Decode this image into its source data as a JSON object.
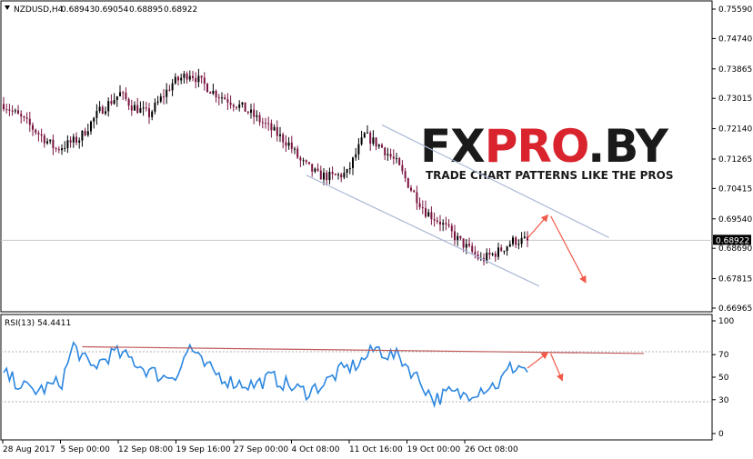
{
  "header": {
    "symbol": "NZDUSD,H4",
    "open": "0.68943",
    "high": "0.69054",
    "low": "0.68895",
    "close": "0.68922"
  },
  "watermark": {
    "logo": "FXPRO.BY",
    "tagline": "TRADE CHART PATTERNS LIKE THE PROS"
  },
  "colors": {
    "bull_candle": "#000000",
    "bear_candle": "#7a1240",
    "rsi_line": "#2b86e0",
    "channel_line": "#aab8d6",
    "trend_line": "#c05a5a",
    "arrow": "#f25a4a",
    "logo_dark": "#1a1a1a",
    "logo_accent": "#d9232d"
  },
  "chart_data": [
    {
      "type": "candlestick",
      "title": "NZDUSD,H4 0.68943 0.69054 0.68895 0.68922",
      "current_price": "0.68922",
      "ylim": [
        0.66965,
        0.7559
      ],
      "y_ticks": [
        "0.75590",
        "0.74740",
        "0.73865",
        "0.73015",
        "0.72140",
        "0.71265",
        "0.70415",
        "0.69540",
        "0.68922",
        "0.68690",
        "0.67815",
        "0.66965"
      ],
      "x_ticks": [
        "28 Aug 2017",
        "5 Sep 00:00",
        "12 Sep 08:00",
        "19 Sep 16:00",
        "27 Sep 00:00",
        "4 Oct 08:00",
        "11 Oct 16:00",
        "19 Oct 00:00",
        "26 Oct 08:00"
      ],
      "close_anchors": {
        "bar_index": [
          0,
          8,
          18,
          26,
          33,
          40,
          44,
          50,
          58,
          64,
          72,
          82,
          90,
          98,
          102,
          108,
          113,
          118,
          124,
          130,
          135,
          140,
          145,
          150,
          156,
          164,
          170,
          175,
          180
        ],
        "close": [
          0.7285,
          0.723,
          0.7155,
          0.7185,
          0.7265,
          0.7315,
          0.728,
          0.7255,
          0.7345,
          0.7375,
          0.732,
          0.7275,
          0.7225,
          0.717,
          0.712,
          0.708,
          0.7075,
          0.7085,
          0.7195,
          0.716,
          0.7115,
          0.704,
          0.6975,
          0.6945,
          0.6895,
          0.6835,
          0.686,
          0.689,
          0.6892
        ]
      },
      "annotations": [
        {
          "kind": "channel_line",
          "from": [
            "bar 130",
            0.7225
          ],
          "to": [
            "bar 208",
            0.69
          ]
        },
        {
          "kind": "channel_line",
          "from": [
            "bar 104",
            0.708
          ],
          "to": [
            "bar 184",
            0.676
          ]
        },
        {
          "kind": "arrow",
          "from": [
            "bar 180",
            0.6898
          ],
          "to": [
            "bar 187",
            0.6965
          ]
        },
        {
          "kind": "arrow",
          "from": [
            "bar 188",
            0.6962
          ],
          "to": [
            "bar 200",
            0.677
          ]
        }
      ]
    },
    {
      "type": "line",
      "title": "RSI(13) 54.4411",
      "series": [
        {
          "name": "RSI(13)",
          "last_value": "54.4411",
          "anchors": {
            "bar_index": [
              0,
              8,
              12,
              20,
              24,
              30,
              38,
              44,
              48,
              55,
              60,
              64,
              68,
              72,
              78,
              86,
              92,
              100,
              104,
              110,
              116,
              122,
              128,
              132,
              136,
              142,
              148,
              153,
              158,
              164,
              170,
              174,
              178,
              180
            ],
            "value": [
              53,
              40,
              38,
              46,
              78,
              58,
              72,
              66,
              58,
              50,
              54,
              78,
              62,
              55,
              46,
              43,
              50,
              40,
              37,
              44,
              56,
              62,
              76,
              70,
              68,
              50,
              30,
              36,
              34,
              40,
              44,
              58,
              60,
              54
            ]
          }
        }
      ],
      "ylim": [
        0,
        100
      ],
      "y_ticks": [
        100,
        70,
        50,
        30,
        0
      ],
      "annotations": [
        {
          "kind": "trend_line",
          "from": [
            "bar 27",
            77
          ],
          "to": [
            "bar 220",
            71
          ]
        },
        {
          "kind": "arrow",
          "from": [
            "bar 180",
            58
          ],
          "to": [
            "bar 187",
            72
          ]
        },
        {
          "kind": "arrow",
          "from": [
            "bar 188",
            71
          ],
          "to": [
            "bar 192",
            47
          ]
        }
      ]
    }
  ]
}
